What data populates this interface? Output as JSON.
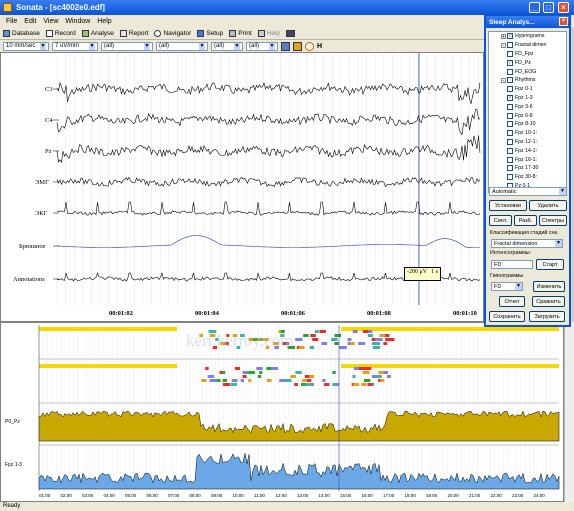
{
  "window": {
    "title": "Sonata - [sc4002e0.edf]"
  },
  "menu": [
    "File",
    "Edit",
    "View",
    "Window",
    "Help"
  ],
  "toolbar": {
    "items": [
      "Database",
      "Record",
      "Analyse",
      "Report",
      "Navigator",
      "Setup",
      "Print",
      "Help"
    ]
  },
  "toolbar2": {
    "speed": "10 mm/sec",
    "amplitude": "7 uV/mm",
    "filter1": "(all)",
    "filter2": "(all)",
    "filter3": "(all)",
    "filter4": "(all)",
    "letter": "H"
  },
  "channels": [
    "C3",
    "C4",
    "Pz",
    "ЭМГ",
    "ЭКГ",
    "Брюшное",
    "Annotations"
  ],
  "time_marks": [
    "00:01:02",
    "00:01:04",
    "00:01:06",
    "00:01:08",
    "00:01:10"
  ],
  "scale_label": "-200 μV",
  "scale_time": "1 s",
  "watermark": "kerr.kerroy.com",
  "bottom": {
    "track_labels": [
      "P0_Pz",
      "Fpz 1-3"
    ],
    "hours": [
      "01:00",
      "02:00",
      "03:00",
      "04:00",
      "05:00",
      "06:00",
      "07:00",
      "08:00",
      "09:00",
      "10:00",
      "11:00",
      "12:00",
      "13:00",
      "14:00",
      "15:00",
      "16:00",
      "17:00",
      "18:00",
      "19:00",
      "20:00",
      "21:00",
      "22:00",
      "23:00",
      "24:00"
    ]
  },
  "panel": {
    "title": "Sleep Analys...",
    "tree": [
      {
        "label": "Hypnograms",
        "indent": 1,
        "checked": true,
        "exp": "+"
      },
      {
        "label": "Fractal dimen",
        "indent": 1,
        "checked": false,
        "exp": "-"
      },
      {
        "label": "FD_Fpz",
        "indent": 2,
        "checked": false
      },
      {
        "label": "FD_Pz",
        "indent": 2,
        "checked": true
      },
      {
        "label": "FD_EOG",
        "indent": 2,
        "checked": false
      },
      {
        "label": "Rhythms",
        "indent": 1,
        "checked": false,
        "exp": "-"
      },
      {
        "label": "Fpz 0-1",
        "indent": 2,
        "checked": false
      },
      {
        "label": "Fpz 1-3",
        "indent": 2,
        "checked": true
      },
      {
        "label": "Fpz 3-6",
        "indent": 2,
        "checked": false
      },
      {
        "label": "Fpz 6-8",
        "indent": 2,
        "checked": false
      },
      {
        "label": "Fpz 8-10",
        "indent": 2,
        "checked": false
      },
      {
        "label": "Fpz 10-1:",
        "indent": 2,
        "checked": false
      },
      {
        "label": "Fpz 12-1:",
        "indent": 2,
        "checked": false
      },
      {
        "label": "Fpz 14-1:",
        "indent": 2,
        "checked": false
      },
      {
        "label": "Fpz 16-1:",
        "indent": 2,
        "checked": false
      },
      {
        "label": "Fpz 17-30",
        "indent": 2,
        "checked": false
      },
      {
        "label": "Fpz 30-8:",
        "indent": 2,
        "checked": false
      },
      {
        "label": "Pz 0-1",
        "indent": 2,
        "checked": false
      }
    ],
    "mode": "Automatic",
    "btn_install": "Установки",
    "btn_delete": "Удалить",
    "btn_synth": "Синт.",
    "btn_split": "Разб.",
    "btn_spectra": "Спектры",
    "classif_label": "Классификация стадий сна",
    "classif_value": "Fractal dimension",
    "intensity_label": "Интенсограммы:",
    "intensity_value": "FD",
    "btn_start": "Старт",
    "hypno_label": "Гипнограммы",
    "hypno_value": "FD",
    "btn_change": "Изменить",
    "btn_report": "Отчет",
    "btn_compare": "Сравнить",
    "btn_save": "Сохранить",
    "btn_load": "Загрузить"
  },
  "status": "Ready"
}
